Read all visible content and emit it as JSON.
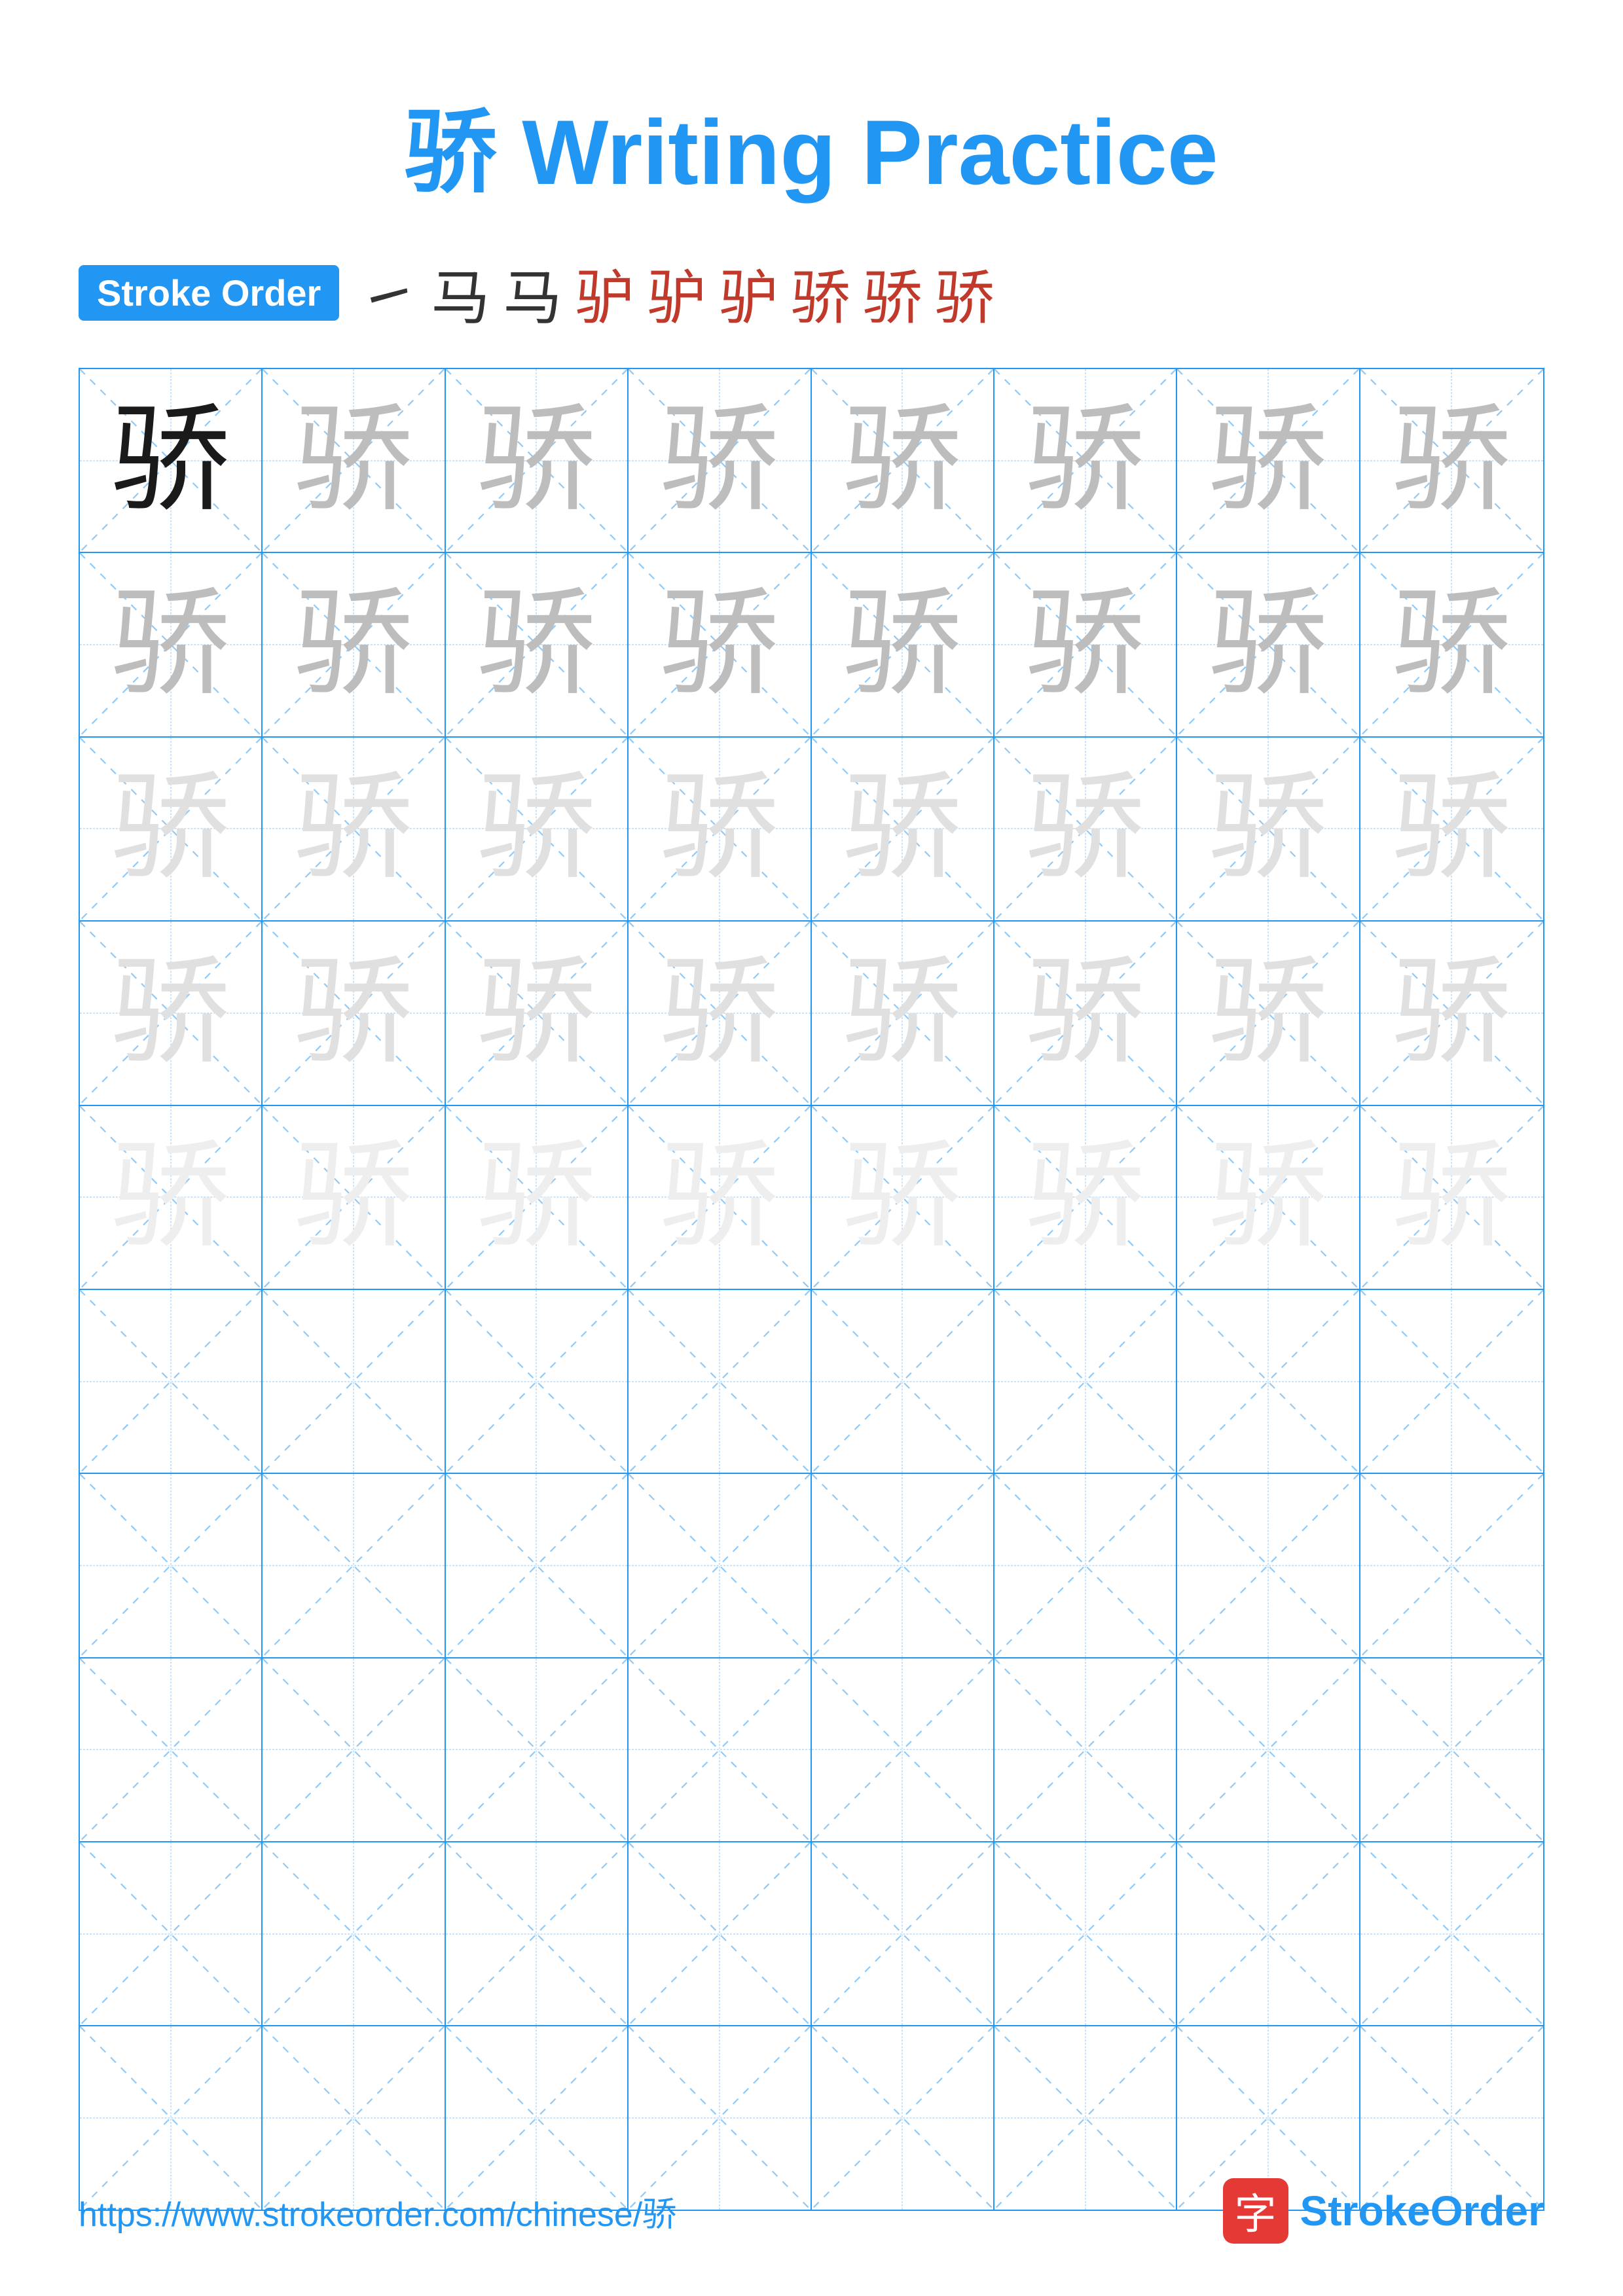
{
  "title": {
    "char": "骄",
    "text": " Writing Practice"
  },
  "stroke_order": {
    "label": "Stroke Order",
    "sequence": [
      "⼀",
      "马",
      "马",
      "驴",
      "驴",
      "驴",
      "骄",
      "骄",
      "骄"
    ]
  },
  "grid": {
    "rows": 10,
    "cols": 8,
    "practice_char": "骄",
    "filled_rows": [
      {
        "opacity": "dark"
      },
      {
        "opacity": "medium"
      },
      {
        "opacity": "medium"
      },
      {
        "opacity": "light"
      },
      {
        "opacity": "very-light"
      },
      {
        "opacity": "empty"
      },
      {
        "opacity": "empty"
      },
      {
        "opacity": "empty"
      },
      {
        "opacity": "empty"
      },
      {
        "opacity": "empty"
      }
    ]
  },
  "footer": {
    "url": "https://www.strokeorder.com/chinese/骄",
    "logo_char": "字",
    "logo_text_stroke": "Stroke",
    "logo_text_order": "Order"
  }
}
